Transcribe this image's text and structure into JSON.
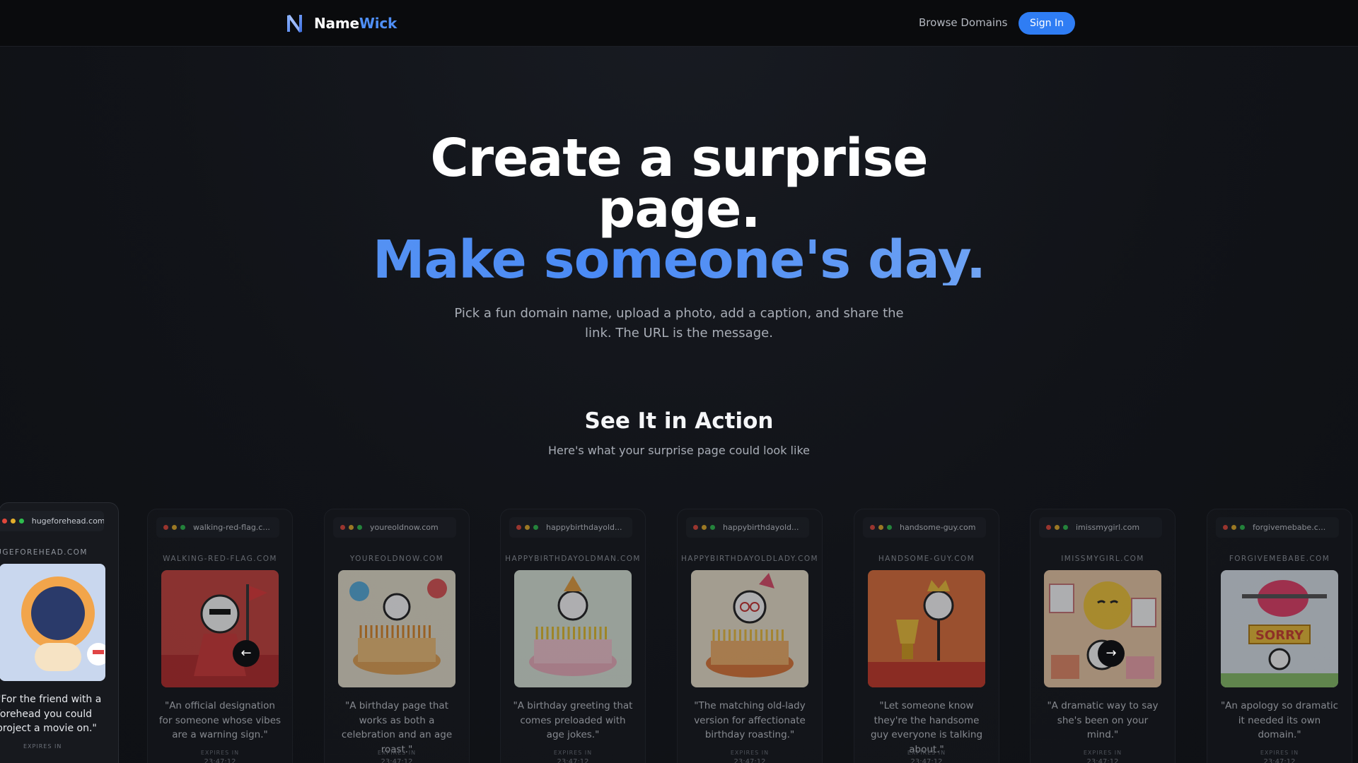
{
  "header": {
    "brand_part1": "Name",
    "brand_part2": "Wick",
    "browse_label": "Browse Domains",
    "signin_label": "Sign In"
  },
  "hero": {
    "title_line1": "Create a surprise",
    "title_line2": "page.",
    "title_line3": "Make someone's day.",
    "subtitle": "Pick a fun domain name, upload a photo, add a caption, and share the link. The URL is the message."
  },
  "showcase": {
    "title": "See It in Action",
    "subtitle": "Here's what your surprise page could look like",
    "expires_label": "EXPIRES IN",
    "timer": "23:47:12",
    "cards": [
      {
        "url": "hugeforehead.com",
        "domain": "HUGEFOREHEAD.COM",
        "caption": "\"For the friend with a forehead you could project a movie on.\"",
        "art": "moviehead",
        "bg": "#c9d7ee"
      },
      {
        "url": "walking-red-flag.c...",
        "domain": "WALKING-RED-FLAG.COM",
        "caption": "\"An official designation for someone whose vibes are a warning sign.\"",
        "art": "redflag",
        "bg": "#c9433e"
      },
      {
        "url": "youreoldnow.com",
        "domain": "YOUREOLDNOW.COM",
        "caption": "\"A birthday page that works as both a celebration and an age roast.\"",
        "art": "cake",
        "bg": "#e9e3cf"
      },
      {
        "url": "happybirthdayold...",
        "domain": "HAPPYBIRTHDAYOLDMAN.COM",
        "caption": "\"A birthday greeting that comes preloaded with age jokes.\"",
        "art": "oldman",
        "bg": "#dfe9dc"
      },
      {
        "url": "happybirthdayold...",
        "domain": "HAPPYBIRTHDAYOLDLADY.COM",
        "caption": "\"The matching old-lady version for affectionate birthday roasting.\"",
        "art": "oldlady",
        "bg": "#efe5cf"
      },
      {
        "url": "handsome-guy.com",
        "domain": "HANDSOME-GUY.COM",
        "caption": "\"Let someone know they're the handsome guy everyone is talking about.\"",
        "art": "trophy",
        "bg": "#e2703c"
      },
      {
        "url": "imissmygirl.com",
        "domain": "IMISSMYGIRL.COM",
        "caption": "\"A dramatic way to say she's been on your mind.\"",
        "art": "sad",
        "bg": "#f0cda9"
      },
      {
        "url": "forgivemebabe.c...",
        "domain": "FORGIVEMEBABE.COM",
        "caption": "\"An apology so dramatic it needed its own domain.\"",
        "art": "sorry",
        "bg": "#dfe7ef"
      }
    ]
  },
  "colors": {
    "accent": "#2f7df4",
    "brand_blue": "#4f8ff7"
  },
  "icons": {
    "prev": "←",
    "next": "→"
  }
}
